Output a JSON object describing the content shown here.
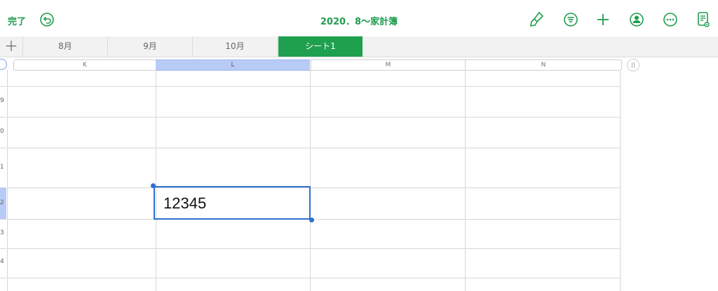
{
  "toolbar": {
    "done_label": "完了",
    "title": "2020．8〜家計簿"
  },
  "tabs": [
    {
      "label": "8月"
    },
    {
      "label": "9月"
    },
    {
      "label": "10月"
    },
    {
      "label": "シート1",
      "active": true
    }
  ],
  "columns": [
    "K",
    "L",
    "M",
    "N"
  ],
  "selected_column": "L",
  "rows": [
    {
      "label": "9"
    },
    {
      "label": "0"
    },
    {
      "label": "1"
    },
    {
      "label": "2"
    },
    {
      "label": "3"
    },
    {
      "label": "4"
    }
  ],
  "selected_row": "2",
  "cell": {
    "value": "12345"
  },
  "colors": {
    "accent_green": "#1f9d4f",
    "selection_blue": "#2f6fd0",
    "header_selected": "#b8cbf6"
  },
  "icons": [
    "undo-icon",
    "paintbrush-icon",
    "format-list-icon",
    "add-icon",
    "collaborate-icon",
    "more-icon",
    "document-view-icon"
  ]
}
